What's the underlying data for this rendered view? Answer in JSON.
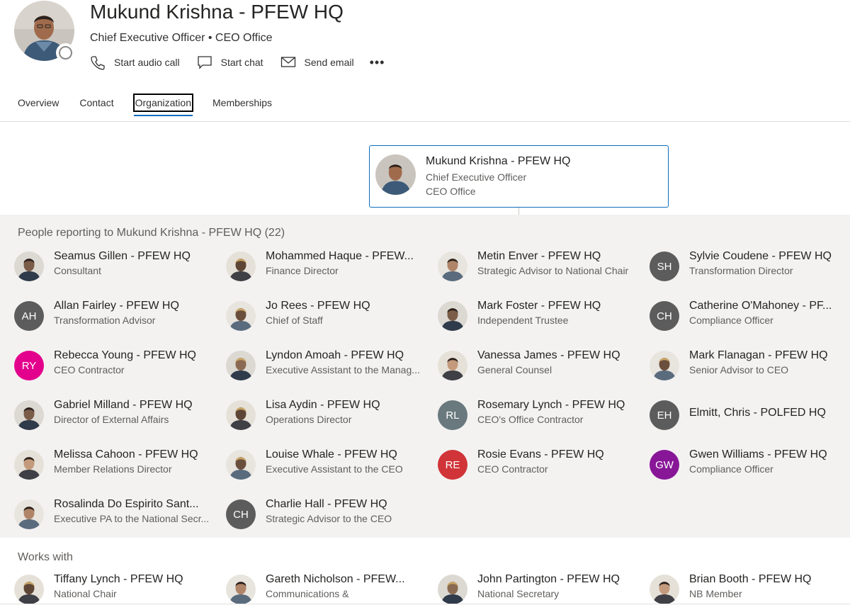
{
  "header": {
    "name": "Mukund Krishna - PFEW HQ",
    "subtitle": "Chief Executive Officer • CEO Office",
    "actions": {
      "audio_call": "Start audio call",
      "chat": "Start chat",
      "email": "Send email",
      "more": "•••"
    }
  },
  "tabs": [
    "Overview",
    "Contact",
    "Organization",
    "Memberships"
  ],
  "active_tab": "Organization",
  "manager_card": {
    "name": "Mukund Krishna - PFEW HQ",
    "title": "Chief Executive Officer",
    "department": "CEO Office"
  },
  "reports_heading": "People reporting to Mukund Krishna - PFEW HQ (22)",
  "reports": [
    {
      "name": "Seamus Gillen - PFEW HQ",
      "role": "Consultant",
      "avatar": "photo"
    },
    {
      "name": "Mohammed Haque - PFEW...",
      "role": "Finance Director",
      "avatar": "photo"
    },
    {
      "name": "Metin Enver - PFEW HQ",
      "role": "Strategic Advisor to National Chair",
      "avatar": "photo"
    },
    {
      "name": "Sylvie Coudene - PFEW HQ",
      "role": "Transformation Director",
      "initials": "SH",
      "color": "#5c5c5c"
    },
    {
      "name": "Allan Fairley - PFEW HQ",
      "role": "Transformation Advisor",
      "initials": "AH",
      "color": "#5c5c5c"
    },
    {
      "name": "Jo Rees - PFEW HQ",
      "role": "Chief of Staff",
      "avatar": "photo"
    },
    {
      "name": "Mark Foster - PFEW HQ",
      "role": "Independent Trustee",
      "avatar": "photo"
    },
    {
      "name": "Catherine O'Mahoney - PF...",
      "role": "Compliance Officer",
      "initials": "CH",
      "color": "#5c5c5c"
    },
    {
      "name": "Rebecca Young - PFEW HQ",
      "role": "CEO Contractor",
      "initials": "RY",
      "color": "#e3008c"
    },
    {
      "name": "Lyndon Amoah - PFEW HQ",
      "role": "Executive Assistant to the Manag...",
      "avatar": "photo"
    },
    {
      "name": "Vanessa James - PFEW HQ",
      "role": "General Counsel",
      "avatar": "photo"
    },
    {
      "name": "Mark Flanagan - PFEW HQ",
      "role": "Senior Advisor to CEO",
      "avatar": "photo"
    },
    {
      "name": "Gabriel Milland - PFEW HQ",
      "role": "Director of External Affairs",
      "avatar": "photo"
    },
    {
      "name": "Lisa Aydin - PFEW HQ",
      "role": "Operations Director",
      "avatar": "photo"
    },
    {
      "name": "Rosemary Lynch - PFEW HQ",
      "role": "CEO's Office Contractor",
      "initials": "RL",
      "color": "#69797e"
    },
    {
      "name": "Elmitt, Chris - POLFED HQ",
      "role": "",
      "initials": "EH",
      "color": "#5c5c5c"
    },
    {
      "name": "Melissa Cahoon - PFEW HQ",
      "role": "Member Relations Director",
      "avatar": "photo"
    },
    {
      "name": "Louise Whale - PFEW HQ",
      "role": "Executive Assistant to the CEO",
      "avatar": "photo"
    },
    {
      "name": "Rosie Evans - PFEW HQ",
      "role": "CEO Contractor",
      "initials": "RE",
      "color": "#d13438"
    },
    {
      "name": "Gwen Williams - PFEW HQ",
      "role": "Compliance Officer",
      "initials": "GW",
      "color": "#881798"
    },
    {
      "name": "Rosalinda Do Espirito Sant...",
      "role": "Executive PA to the National Secr...",
      "avatar": "photo"
    },
    {
      "name": "Charlie Hall - PFEW HQ",
      "role": "Strategic Advisor to the CEO",
      "initials": "CH",
      "color": "#5c5c5c"
    }
  ],
  "works_with_heading": "Works with",
  "works_with": [
    {
      "name": "Tiffany Lynch - PFEW HQ",
      "role": "National Chair",
      "avatar": "photo"
    },
    {
      "name": "Gareth Nicholson  - PFEW...",
      "role": "Communications &",
      "avatar": "photo"
    },
    {
      "name": "John Partington - PFEW HQ",
      "role": "National Secretary",
      "avatar": "photo"
    },
    {
      "name": "Brian Booth - PFEW HQ",
      "role": "NB Member",
      "avatar": "photo"
    }
  ],
  "colors": {
    "accent": "#0f6cbd",
    "section_bg": "#f3f2f1"
  }
}
